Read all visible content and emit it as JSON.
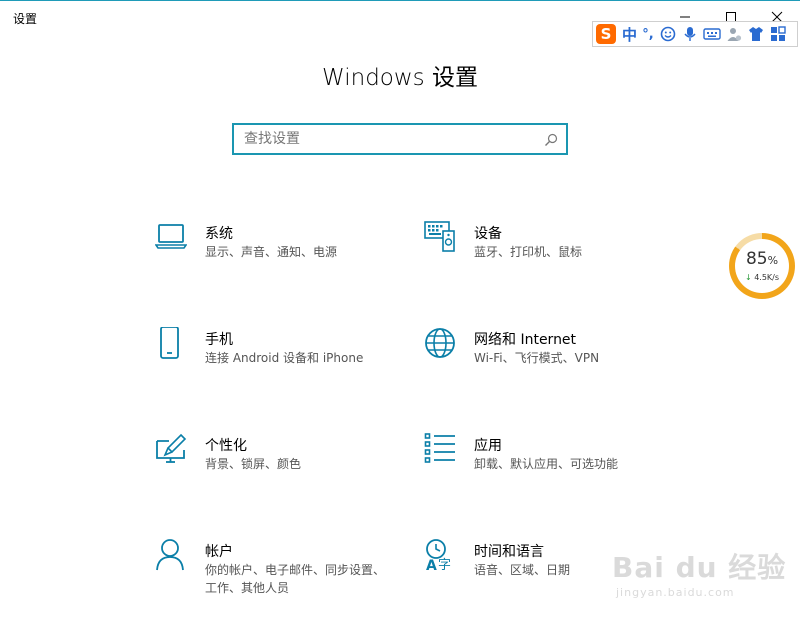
{
  "window": {
    "title": "设置"
  },
  "ime": {
    "logo": "S",
    "mode": "中",
    "punctuation": "°,"
  },
  "page": {
    "title": "Windows 设置"
  },
  "search": {
    "placeholder": "查找设置",
    "value": ""
  },
  "categories": [
    {
      "title": "系统",
      "desc": "显示、声音、通知、电源",
      "icon": "laptop-icon"
    },
    {
      "title": "设备",
      "desc": "蓝牙、打印机、鼠标",
      "icon": "devices-icon"
    },
    {
      "title": "手机",
      "desc": "连接 Android 设备和 iPhone",
      "icon": "phone-icon"
    },
    {
      "title": "网络和 Internet",
      "desc": "Wi-Fi、飞行模式、VPN",
      "icon": "globe-icon"
    },
    {
      "title": "个性化",
      "desc": "背景、锁屏、颜色",
      "icon": "personalization-icon"
    },
    {
      "title": "应用",
      "desc": "卸载、默认应用、可选功能",
      "icon": "apps-icon"
    },
    {
      "title": "帐户",
      "desc": "你的帐户、电子邮件、同步设置、工作、其他人员",
      "icon": "account-icon"
    },
    {
      "title": "时间和语言",
      "desc": "语音、区域、日期",
      "icon": "time-language-icon"
    }
  ],
  "speed_widget": {
    "percent": "85",
    "percent_sign": "%",
    "rate": "4.5K/s",
    "fill_fraction": 0.85
  },
  "watermark": {
    "main": "Bai du 经验",
    "sub": "jingyan.baidu.com"
  },
  "colors": {
    "accent": "#1a96b1",
    "icon": "#0b7fa8",
    "ring": "#f2a51a"
  }
}
